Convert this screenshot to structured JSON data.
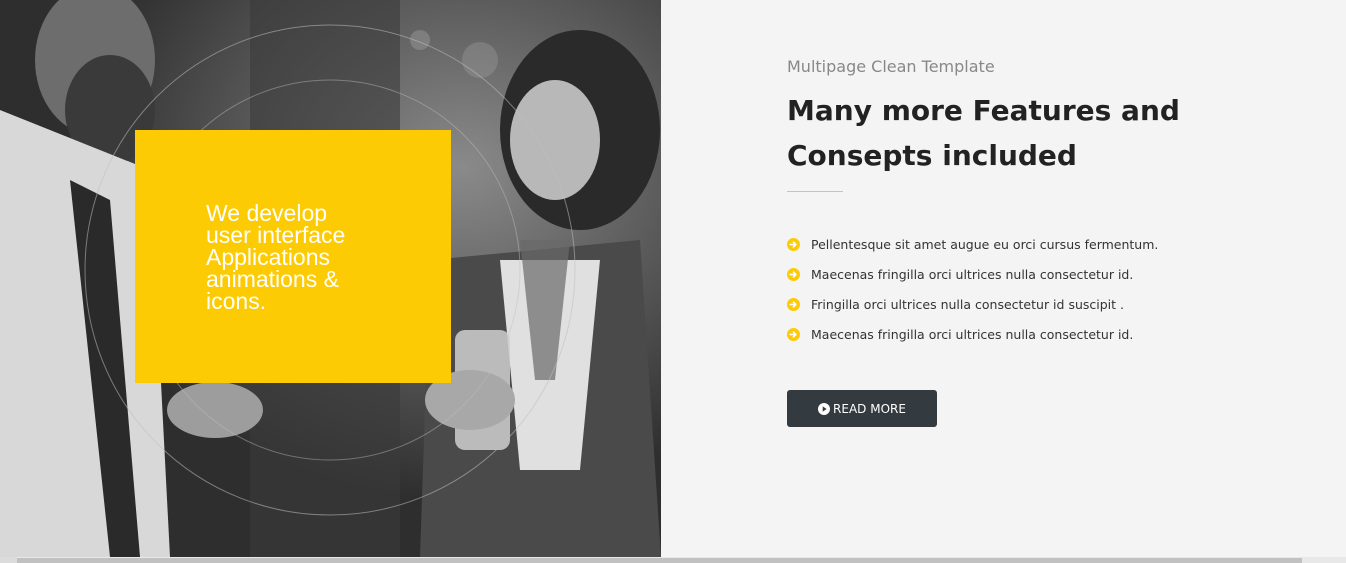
{
  "hero": {
    "overlay_lines": [
      "We develop",
      "user interface",
      "Applications",
      "animations &",
      "icons."
    ]
  },
  "content": {
    "subtitle": "Multipage Clean Template",
    "heading_lines": [
      "Many more Features and",
      "Consepts included"
    ],
    "features": [
      "Pellentesque sit amet augue eu orci cursus fermentum.",
      "Maecenas fringilla orci ultrices nulla consectetur id.",
      "Fringilla orci ultrices nulla consectetur id suscipit .",
      "Maecenas fringilla orci ultrices nulla consectetur id."
    ],
    "bullet_icon": "arrow-circle-right-icon",
    "button": {
      "label": "READ MORE",
      "icon": "play-circle-icon"
    }
  },
  "colors": {
    "accent_yellow": "#fdcb04",
    "button_dark": "#333a40",
    "panel_background": "#f4f4f4",
    "heading_text": "#222222",
    "subtitle_text": "#888888"
  }
}
